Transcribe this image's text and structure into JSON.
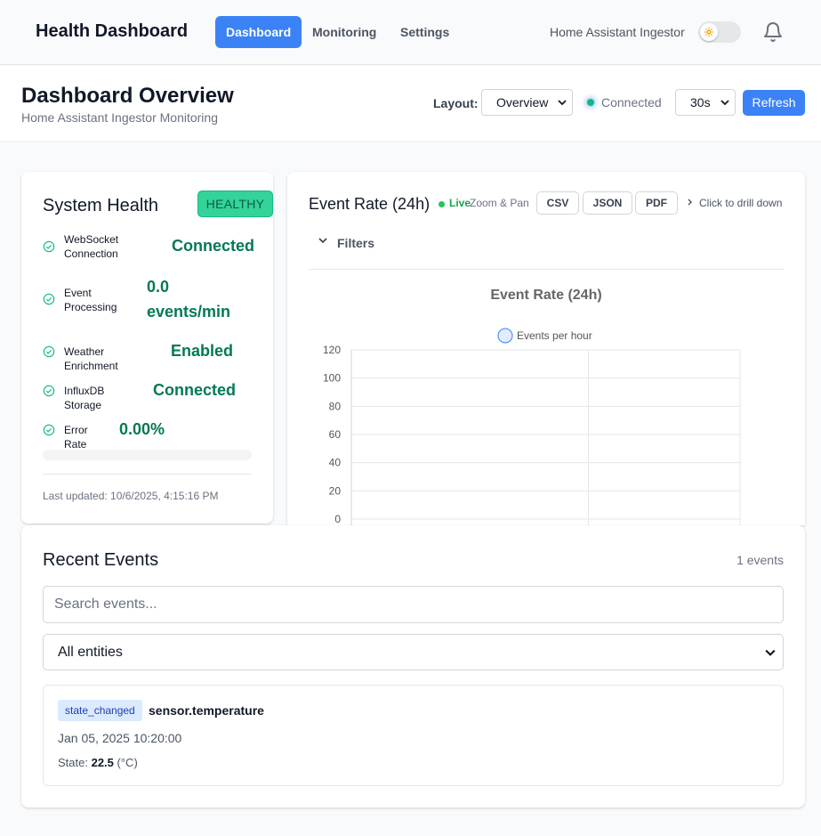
{
  "nav": {
    "brand": "Health Dashboard",
    "links": [
      {
        "label": "Dashboard",
        "active": true
      },
      {
        "label": "Monitoring",
        "active": false
      },
      {
        "label": "Settings",
        "active": false
      }
    ],
    "app_name": "Home Assistant Ingestor",
    "theme_toggle_icon": "sun-icon",
    "notification_icon": "bell-icon"
  },
  "header": {
    "title": "Dashboard Overview",
    "subtitle": "Home Assistant Ingestor Monitoring",
    "layout_label": "Layout:",
    "layout_value": "Overview",
    "connection_status": "Connected",
    "refresh_interval": "30s",
    "refresh_label": "Refresh"
  },
  "health": {
    "title": "System Health",
    "status_badge": "HEALTHY",
    "rows": [
      {
        "label": "WebSocket Connection",
        "value": "Connected"
      },
      {
        "label": "Event Processing",
        "value": "0.0 events/min"
      },
      {
        "label": "Weather Enrichment",
        "value": "Enabled"
      },
      {
        "label": "InfluxDB Storage",
        "value": "Connected"
      },
      {
        "label": "Error Rate",
        "value": "0.00%"
      }
    ],
    "last_updated": "Last updated: 10/6/2025, 4:15:16 PM"
  },
  "chart_panel": {
    "title": "Event Rate (24h)",
    "live_label": "Live",
    "zoom_label": "Zoom & Pan",
    "export_buttons": [
      "CSV",
      "JSON",
      "PDF"
    ],
    "drill_hint": "Click to drill down",
    "filters_label": "Filters"
  },
  "chart_data": {
    "type": "line",
    "title": "Event Rate (24h)",
    "series": [
      {
        "name": "Events per hour",
        "values": []
      }
    ],
    "y_ticks": [
      "120",
      "100",
      "80",
      "60",
      "40",
      "20",
      "0"
    ],
    "ylim": [
      0,
      120
    ],
    "grid": true,
    "legend_position": "top"
  },
  "events": {
    "title": "Recent Events",
    "count_label": "1 events",
    "search_placeholder": "Search events...",
    "entity_filter": "All entities",
    "items": [
      {
        "type": "state_changed",
        "entity": "sensor.temperature",
        "time": "Jan 05, 2025 10:20:00",
        "state_label": "State:",
        "state_value": "22.5",
        "unit": "(°C)"
      }
    ]
  },
  "colors": {
    "primary": "#3b82f6",
    "healthy": "#34d399",
    "success_text": "#047857",
    "live": "#22c55e"
  }
}
